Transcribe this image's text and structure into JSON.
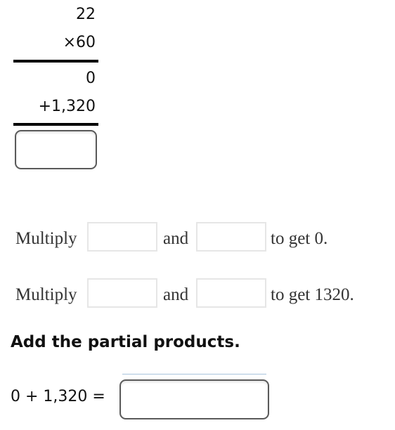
{
  "vertical_multiplication": {
    "multiplicand": "22",
    "multiplier": "×60",
    "partial_product_1": "0",
    "partial_product_2": "+1,320",
    "final_answer_value": ""
  },
  "steps": [
    {
      "prefix": "Multiply",
      "connector": "and",
      "suffix": "to get 0.",
      "input_a": "",
      "input_b": ""
    },
    {
      "prefix": "Multiply",
      "connector": "and",
      "suffix": "to get 1320.",
      "input_a": "",
      "input_b": ""
    }
  ],
  "add_section": {
    "heading": "Add the partial products.",
    "equation": "0 + 1,320 =",
    "answer_value": ""
  }
}
